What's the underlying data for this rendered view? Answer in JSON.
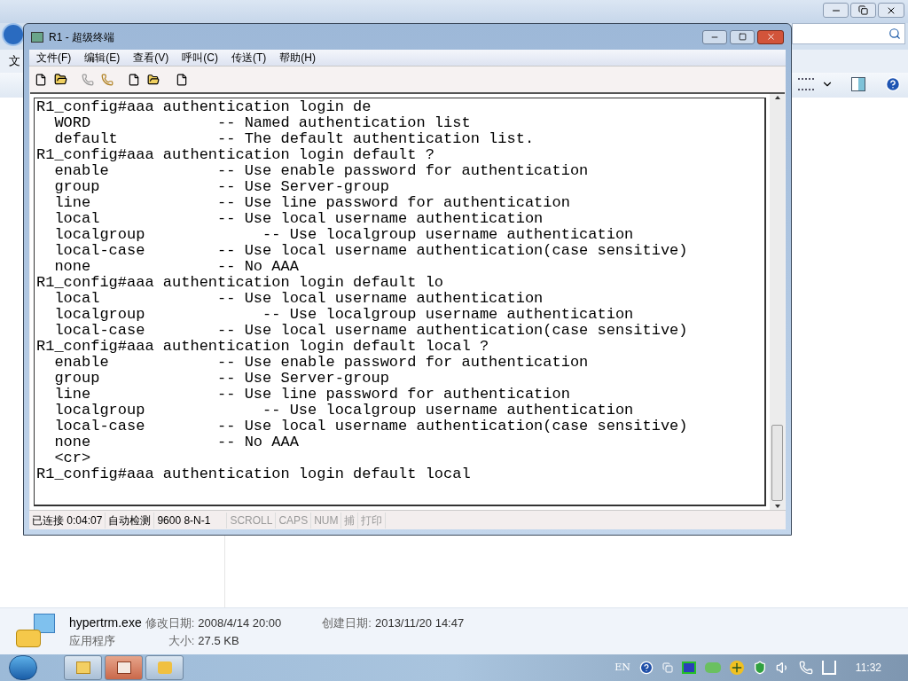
{
  "explorer": {
    "menu_partial": "文"
  },
  "terminal_window": {
    "title": "R1 - 超级终端",
    "menu": [
      "文件(F)",
      "编辑(E)",
      "查看(V)",
      "呼叫(C)",
      "传送(T)",
      "帮助(H)"
    ],
    "lines": [
      "R1_config#aaa authentication login de",
      "  WORD              -- Named authentication list",
      "  default           -- The default authentication list.",
      "R1_config#aaa authentication login default ?",
      "  enable            -- Use enable password for authentication",
      "  group             -- Use Server-group",
      "  line              -- Use line password for authentication",
      "  local             -- Use local username authentication",
      "  localgroup             -- Use localgroup username authentication",
      "  local-case        -- Use local username authentication(case sensitive)",
      "  none              -- No AAA",
      "R1_config#aaa authentication login default lo",
      "  local             -- Use local username authentication",
      "  localgroup             -- Use localgroup username authentication",
      "  local-case        -- Use local username authentication(case sensitive)",
      "R1_config#aaa authentication login default local ?",
      "  enable            -- Use enable password for authentication",
      "  group             -- Use Server-group",
      "  line              -- Use line password for authentication",
      "  localgroup             -- Use localgroup username authentication",
      "  local-case        -- Use local username authentication(case sensitive)",
      "  none              -- No AAA",
      "  <cr>",
      "R1_config#aaa authentication login default local"
    ],
    "status_bar": [
      {
        "text": "已连接 0:04:07",
        "active": true
      },
      {
        "text": "自动检测",
        "active": true
      },
      {
        "text": "9600 8-N-1",
        "active": true
      },
      {
        "text": "SCROLL",
        "active": false
      },
      {
        "text": "CAPS",
        "active": false
      },
      {
        "text": "NUM",
        "active": false
      },
      {
        "text": "捕",
        "active": false
      },
      {
        "text": "打印",
        "active": false
      }
    ]
  },
  "details": {
    "name": "hypertrm.exe",
    "modified_label": "修改日期:",
    "modified": "2008/4/14 20:00",
    "created_label": "创建日期:",
    "created": "2013/11/20 14:47",
    "type": "应用程序",
    "size_label": "大小:",
    "size": "27.5 KB"
  },
  "taskbar": {
    "buttons": [
      {
        "selected": false
      },
      {
        "selected": true
      },
      {
        "selected": false
      }
    ],
    "language": "EN",
    "clock": "11:32"
  }
}
